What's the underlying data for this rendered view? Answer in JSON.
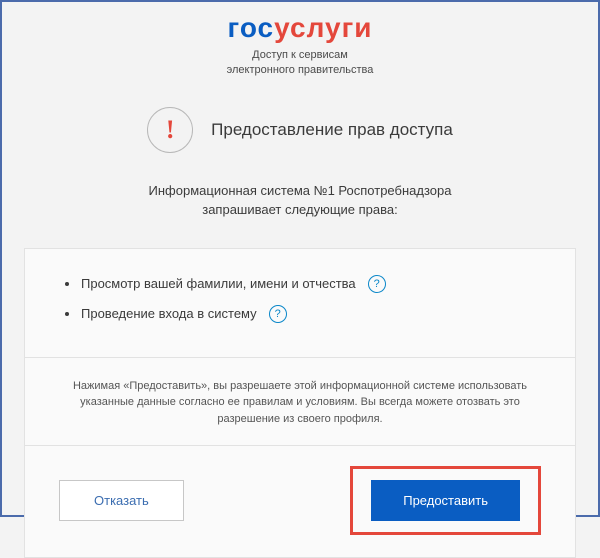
{
  "logo": {
    "part1": "гос",
    "part2": "услуги"
  },
  "subtitle": {
    "line1": "Доступ к сервисам",
    "line2": "электронного правительства"
  },
  "alert": {
    "symbol": "!",
    "title": "Предоставление прав доступа"
  },
  "request": {
    "line1": "Информационная система №1 Роспотребнадзора",
    "line2": "запрашивает следующие права:"
  },
  "rights": [
    "Просмотр вашей фамилии, имени и отчества",
    "Проведение входа в систему"
  ],
  "help_symbol": "?",
  "disclaimer": "Нажимая «Предоставить», вы разрешаете этой информационной системе использовать указанные данные согласно ее правилам и условиям. Вы всегда можете отозвать это разрешение из своего профиля.",
  "buttons": {
    "deny": "Отказать",
    "allow": "Предоставить"
  }
}
